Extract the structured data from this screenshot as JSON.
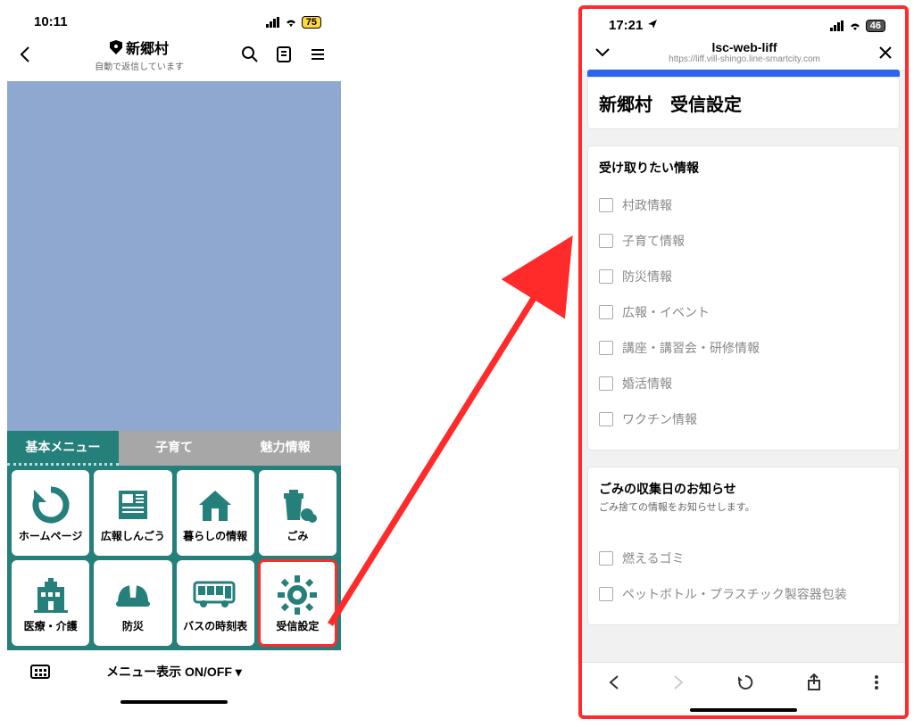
{
  "left": {
    "status": {
      "time": "10:11",
      "battery": "75"
    },
    "header": {
      "title": "新郷村",
      "subtitle": "自動で返信しています"
    },
    "tabs": [
      "基本メニュー",
      "子育て",
      "魅力情報"
    ],
    "tiles": [
      {
        "label": "ホームページ"
      },
      {
        "label": "広報しんごう"
      },
      {
        "label": "暮らしの情報"
      },
      {
        "label": "ごみ"
      },
      {
        "label": "医療・介護"
      },
      {
        "label": "防災"
      },
      {
        "label": "バスの時刻表"
      },
      {
        "label": "受信設定"
      }
    ],
    "toggle_label": "メニュー表示 ON/OFF ▾"
  },
  "right": {
    "status": {
      "time": "17:21",
      "battery": "46"
    },
    "sheet": {
      "title": "lsc-web-liff",
      "url": "https://liff.vill-shingo.line-smartcity.com"
    },
    "page_title": "新郷村　受信設定",
    "section1": {
      "title": "受け取りたい情報",
      "options": [
        "村政情報",
        "子育て情報",
        "防災情報",
        "広報・イベント",
        "講座・講習会・研修情報",
        "婚活情報",
        "ワクチン情報"
      ]
    },
    "section2": {
      "title": "ごみの収集日のお知らせ",
      "subtitle": "ごみ捨ての情報をお知らせします。",
      "options": [
        "燃えるゴミ",
        "ペットボトル・プラスチック製容器包装"
      ]
    }
  }
}
